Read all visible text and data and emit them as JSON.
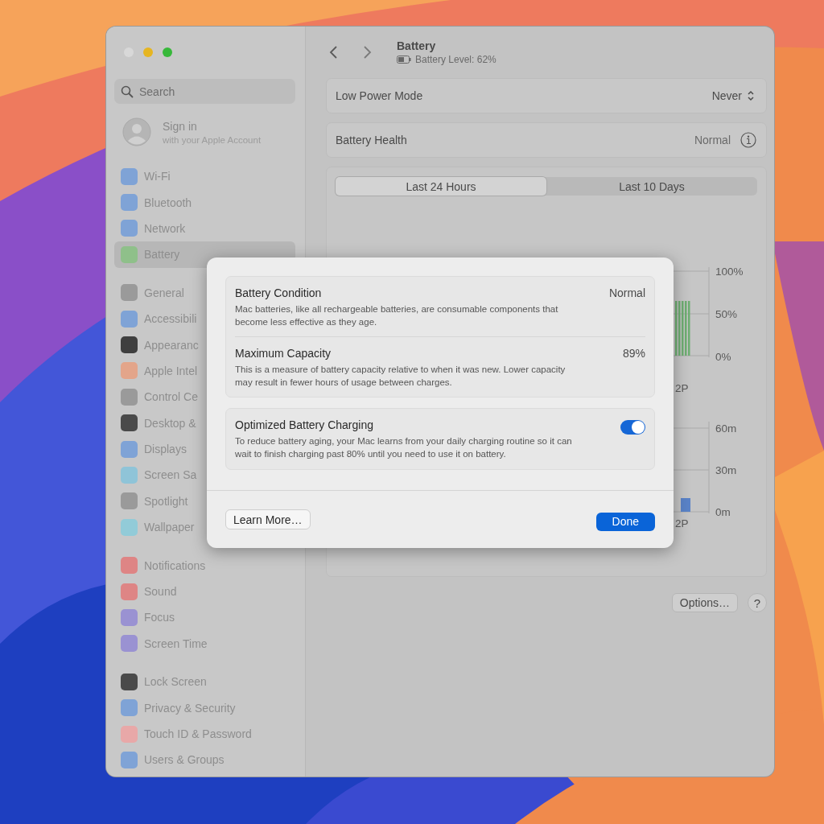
{
  "window": {
    "sidebar": {
      "search": {
        "placeholder": "Search"
      },
      "account": {
        "title": "Sign in",
        "subtitle": "with your Apple Account"
      },
      "groups": [
        {
          "items": [
            {
              "label": "Wi-Fi",
              "color": "#7fa3d6",
              "selected": false
            },
            {
              "label": "Bluetooth",
              "color": "#7fa3d6",
              "selected": false
            },
            {
              "label": "Network",
              "color": "#7fa3d6",
              "selected": false
            },
            {
              "label": "Battery",
              "color": "#8fc08a",
              "selected": true
            }
          ]
        },
        {
          "items": [
            {
              "label": "General",
              "color": "#9a9a9a",
              "selected": false
            },
            {
              "label": "Accessibili",
              "color": "#7fa3d6",
              "selected": false
            },
            {
              "label": "Appearanc",
              "color": "#3f3f3f",
              "selected": false
            },
            {
              "label": "Apple Intel",
              "color": "#e3a58a",
              "selected": false
            },
            {
              "label": "Control Ce",
              "color": "#9a9a9a",
              "selected": false
            },
            {
              "label": "Desktop &",
              "color": "#4a4a4a",
              "selected": false
            },
            {
              "label": "Displays",
              "color": "#7fa3d6",
              "selected": false
            },
            {
              "label": "Screen Sa",
              "color": "#8fc4d8",
              "selected": false
            },
            {
              "label": "Spotlight",
              "color": "#9a9a9a",
              "selected": false
            },
            {
              "label": "Wallpaper",
              "color": "#92cbd8",
              "selected": false
            }
          ]
        },
        {
          "items": [
            {
              "label": "Notifications",
              "color": "#de8585",
              "selected": false
            },
            {
              "label": "Sound",
              "color": "#de8585",
              "selected": false
            },
            {
              "label": "Focus",
              "color": "#9a92d2",
              "selected": false
            },
            {
              "label": "Screen Time",
              "color": "#9a92d2",
              "selected": false
            }
          ]
        },
        {
          "items": [
            {
              "label": "Lock Screen",
              "color": "#4a4a4a",
              "selected": false
            },
            {
              "label": "Privacy & Security",
              "color": "#7fa3d6",
              "selected": false
            },
            {
              "label": "Touch ID & Password",
              "color": "#e8a8a8",
              "selected": false
            },
            {
              "label": "Users & Groups",
              "color": "#7fa3d6",
              "selected": false
            }
          ]
        }
      ]
    },
    "header": {
      "title": "Battery",
      "subtitle": "Battery Level: 62%"
    },
    "rows": [
      {
        "kind": "popup",
        "label": "Low Power Mode",
        "value": "Never"
      },
      {
        "kind": "info",
        "label": "Battery Health",
        "value": "Normal"
      }
    ],
    "usage": {
      "tabs": [
        {
          "label": "Last 24 Hours",
          "selected": true
        },
        {
          "label": "Last 10 Days",
          "selected": false
        }
      ],
      "level_axis": [
        "100%",
        "50%",
        "0%"
      ],
      "level_time_label": "2P",
      "activity_axis": [
        "60m",
        "30m",
        "0m"
      ],
      "activity_time_label": "2P"
    },
    "buttons": [
      {
        "kind": "text",
        "label": "Options…"
      },
      {
        "kind": "help",
        "label": "?"
      }
    ]
  },
  "dialog": {
    "sections": [
      {
        "items": [
          {
            "kind": "info",
            "title": "Battery Condition",
            "description": "Mac batteries, like all rechargeable batteries, are consumable components that become less effective as they age.",
            "value": "Normal"
          },
          {
            "kind": "info",
            "title": "Maximum Capacity",
            "description": "This is a measure of battery capacity relative to when it was new. Lower capacity may result in fewer hours of usage between charges.",
            "value": "89%"
          }
        ]
      },
      {
        "items": [
          {
            "kind": "toggle",
            "title": "Optimized Battery Charging",
            "description": "To reduce battery aging, your Mac learns from your daily charging routine so it can wait to finish charging past 80% until you need to use it on battery.",
            "on": true
          }
        ]
      }
    ],
    "buttons": [
      {
        "kind": "secondary",
        "label": "Learn More…"
      },
      {
        "kind": "primary",
        "label": "Done"
      }
    ]
  }
}
